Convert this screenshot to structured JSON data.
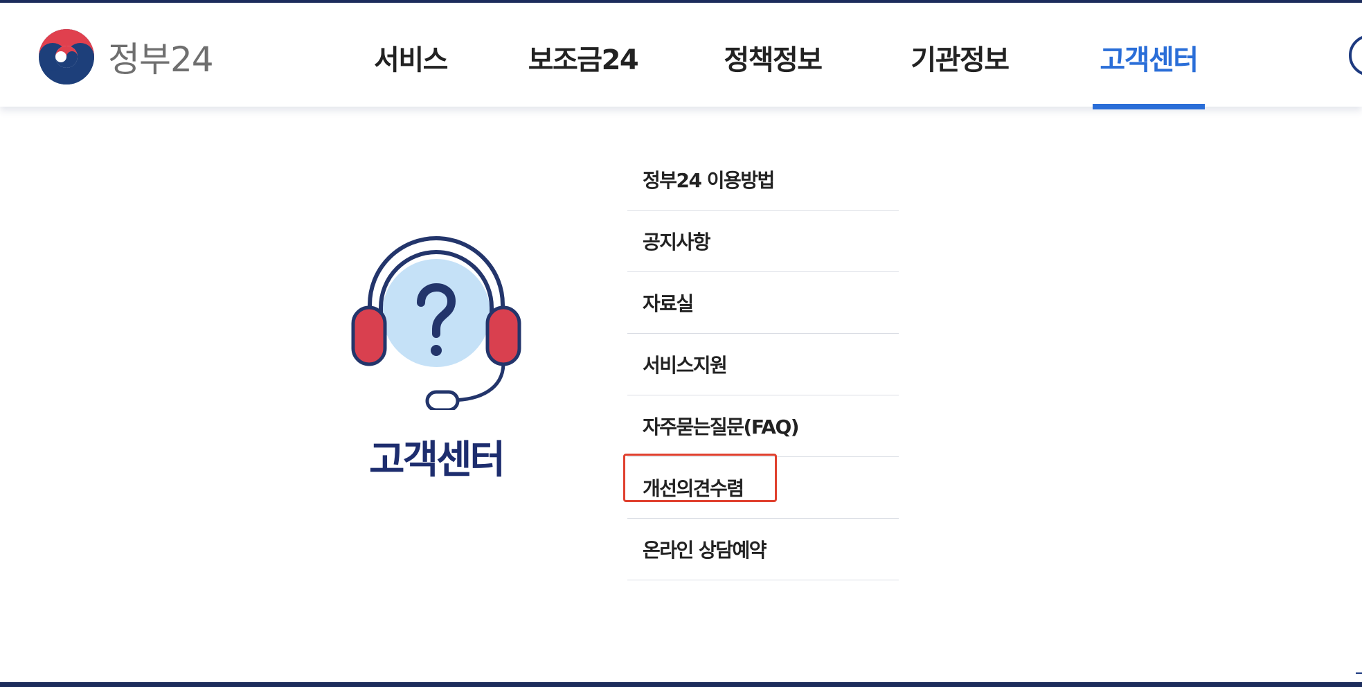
{
  "brand": {
    "logo_text": "정부24",
    "colors": {
      "brand_navy": "#1d2d5c",
      "brand_red": "#e0404e",
      "accent_blue": "#2a6ed8"
    }
  },
  "nav": {
    "items": [
      {
        "label": "서비스",
        "active": false
      },
      {
        "label": "보조금24",
        "active": false
      },
      {
        "label": "정책정보",
        "active": false
      },
      {
        "label": "기관정보",
        "active": false
      },
      {
        "label": "고객센터",
        "active": true
      }
    ]
  },
  "customer_center": {
    "title": "고객센터",
    "icon": "headset-question-icon",
    "menu": [
      {
        "label": "정부24 이용방법"
      },
      {
        "label": "공지사항"
      },
      {
        "label": "자료실"
      },
      {
        "label": "서비스지원",
        "highlighted": true
      },
      {
        "label": "자주묻는질문(FAQ)"
      },
      {
        "label": "개선의견수렴"
      },
      {
        "label": "온라인 상담예약"
      }
    ]
  }
}
